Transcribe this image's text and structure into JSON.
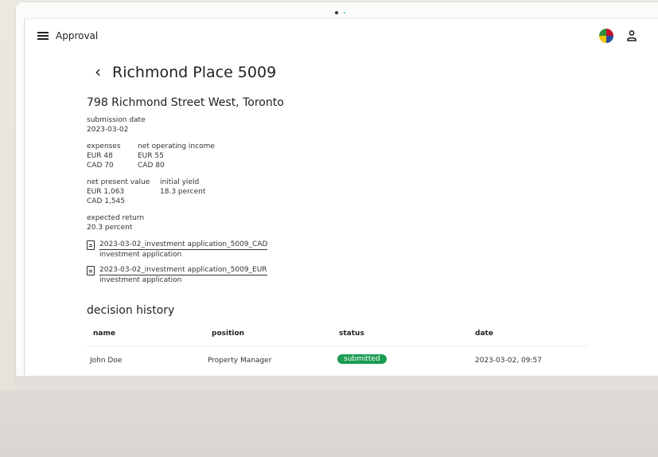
{
  "app": {
    "title": "Approval"
  },
  "page": {
    "title": "Richmond Place 5009",
    "address": "798 Richmond Street West, Toronto"
  },
  "details": {
    "submission_date": {
      "label": "submission date",
      "value": "2023-03-02"
    },
    "expenses": {
      "label": "expenses",
      "values": [
        "EUR 48",
        "CAD 70"
      ]
    },
    "net_operating_income": {
      "label": "net operating income",
      "values": [
        "EUR 55",
        "CAD 80"
      ]
    },
    "net_present_value": {
      "label": "net present value",
      "values": [
        "EUR 1,063",
        "CAD 1,545"
      ]
    },
    "initial_yield": {
      "label": "initial yield",
      "value": "18.3 percent"
    },
    "expected_return": {
      "label": "expected return",
      "value": "20.3 percent"
    }
  },
  "documents": [
    {
      "name": "2023-03-02_investment application_5009_CAD",
      "type": "investment application"
    },
    {
      "name": "2023-03-02_investment application_5009_EUR",
      "type": "investment application"
    }
  ],
  "history": {
    "title": "decision history",
    "columns": [
      "name",
      "position",
      "status",
      "date"
    ],
    "rows": [
      {
        "name": "John Doe",
        "position": "Property Manager",
        "status": "submitted",
        "date": "2023-03-02, 09:57"
      }
    ]
  },
  "colors": {
    "status_submitted": "#1a9c52",
    "screen_bg": "#ffffff"
  },
  "icons": {
    "menu": "hamburger-menu-icon",
    "language": "flag-globe-icon",
    "user": "user-icon",
    "back": "chevron-left-icon",
    "document": "document-icon"
  }
}
